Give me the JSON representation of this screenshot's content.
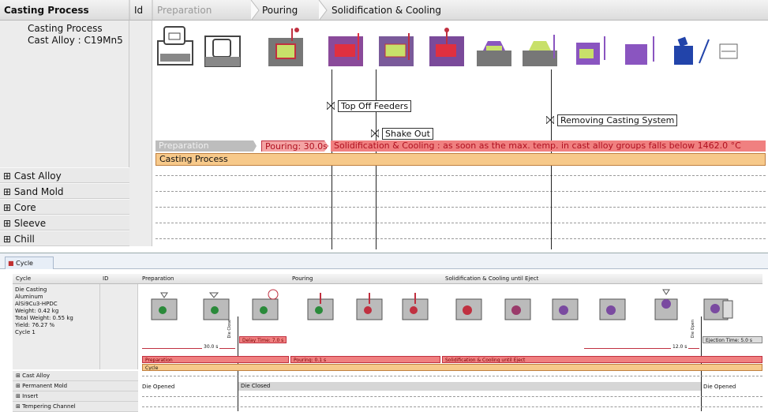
{
  "top": {
    "header": {
      "col_process": "Casting Process",
      "col_id": "Id",
      "phase_preparation": "Preparation",
      "phase_pouring": "Pouring",
      "phase_solidification": "Solidification & Cooling"
    },
    "process": {
      "title": "Casting Process",
      "alloy": "Cast Alloy : C19Mn5"
    },
    "annotations": {
      "top_off": "Top Off Feeders",
      "shake_out": "Shake Out",
      "removing": "Removing Casting System"
    },
    "bars": {
      "preparation": "Preparation",
      "pouring": "Pouring: 30.0s",
      "solidification": "Solidification & Cooling : as soon as the max. temp. in cast alloy groups falls below 1462.0 °C",
      "casting_process": "Casting Process"
    },
    "tree": [
      "Cast Alloy",
      "Sand Mold",
      "Core",
      "Sleeve",
      "Chill"
    ],
    "expand_glyph": "⊞"
  },
  "bottom": {
    "tab_label": "Cycle",
    "header": {
      "col_cycle": "Cycle",
      "col_id": "ID",
      "phase_preparation": "Preparation",
      "phase_pouring": "Pouring",
      "phase_solidification": "Solidification & Cooling until Eject"
    },
    "info": [
      "Die Casting",
      "Aluminum",
      "AlSi9Cu3-HPDC",
      "Weight: 0.42 kg",
      "Total Weight: 0.55 kg",
      "Yield: 76.27 %",
      "Cycle 1"
    ],
    "markers": {
      "die_close": "Die Close",
      "die_open": "Die Open",
      "delay": "Delay Time: 7.0 s",
      "ejection": "Ejection Time: 5.0 s",
      "dist1": "30.0 s",
      "dist2": "12.0 s"
    },
    "bars": {
      "preparation": "Preparation",
      "pouring": "Pouring: 0.1 s",
      "solidification": "Solidification & Cooling until Eject",
      "cycle": "Cycle"
    },
    "tree": [
      "Cast Alloy",
      "Permanent Mold",
      "Insert",
      "Tempering Channel"
    ],
    "mold_states": {
      "opened": "Die Opened",
      "closed": "Die Closed",
      "opened2": "Die Opened"
    }
  },
  "colors": {
    "pour_bar": "#f08080",
    "process_bar": "#f7c98a",
    "prep_bar": "#b8b8b8",
    "mold_red": "#e03040",
    "mold_green": "#c8e06a",
    "mold_purple": "#8a55c0",
    "mold_blue": "#2244aa"
  }
}
